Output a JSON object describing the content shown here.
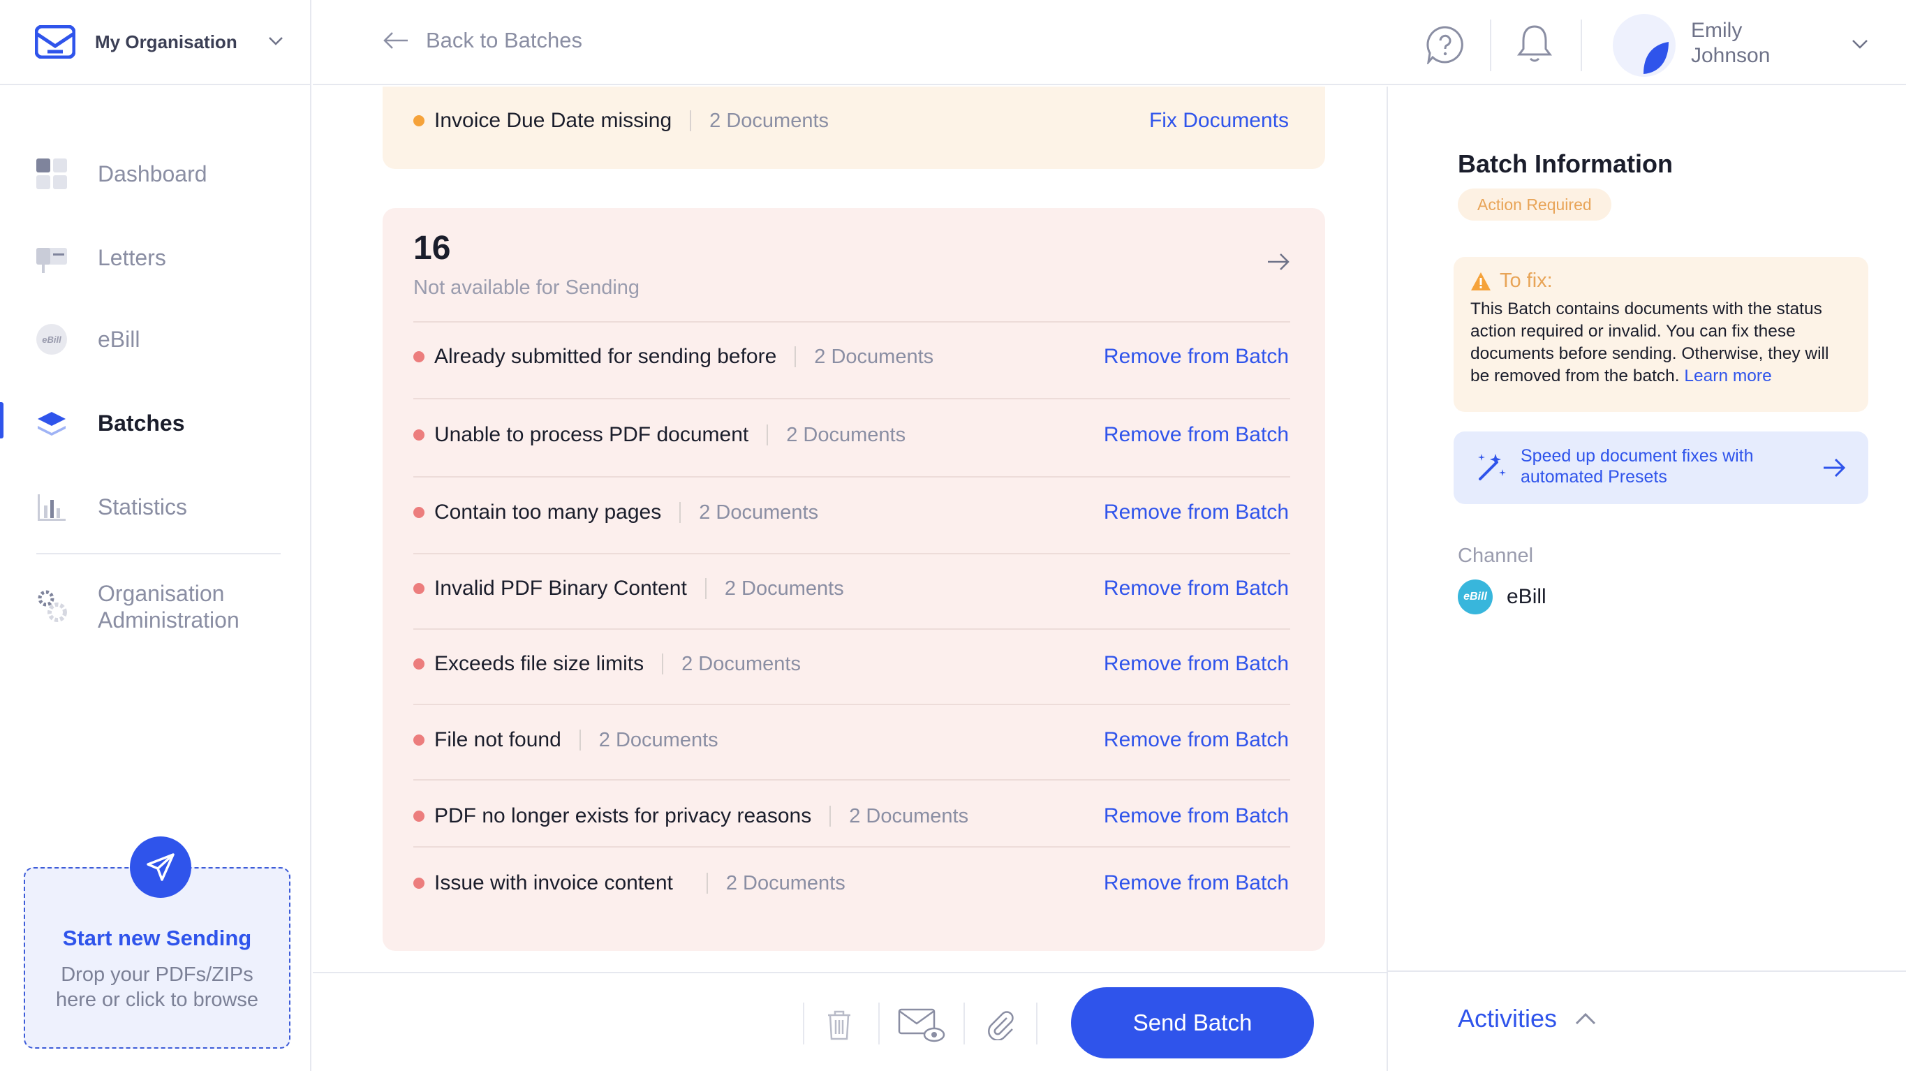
{
  "sidebar": {
    "org_name": "My Organisation",
    "nav": [
      {
        "label": "Dashboard",
        "icon": "dashboard-icon"
      },
      {
        "label": "Letters",
        "icon": "letters-icon"
      },
      {
        "label": "eBill",
        "icon": "ebill-icon"
      },
      {
        "label": "Batches",
        "icon": "batches-icon",
        "active": true
      },
      {
        "label": "Statistics",
        "icon": "statistics-icon"
      },
      {
        "label": "Organisation Administration",
        "icon": "settings-icon"
      }
    ],
    "ebill_badge": "eBill",
    "dropzone": {
      "title": "Start new Sending",
      "subtitle": "Drop your PDFs/ZIPs here or click to browse"
    }
  },
  "topbar": {
    "back_label": "Back to Batches",
    "user": {
      "first": "Emily",
      "last": "Johnson"
    }
  },
  "warning_group": {
    "issue": "Invoice Due Date missing",
    "count": "2 Documents",
    "action": "Fix Documents"
  },
  "error_group": {
    "count": "16",
    "subtitle": "Not available for Sending",
    "rows": [
      {
        "issue": "Already submitted for sending before",
        "count": "2 Documents",
        "action": "Remove from Batch"
      },
      {
        "issue": "Unable to process PDF document",
        "count": "2 Documents",
        "action": "Remove from Batch"
      },
      {
        "issue": "Contain too many pages",
        "count": "2 Documents",
        "action": "Remove from Batch"
      },
      {
        "issue": "Invalid PDF Binary Content",
        "count": "2 Documents",
        "action": "Remove from Batch"
      },
      {
        "issue": "Exceeds file size limits",
        "count": "2 Documents",
        "action": "Remove from Batch"
      },
      {
        "issue": "File not found",
        "count": "2 Documents",
        "action": "Remove from Batch"
      },
      {
        "issue": "PDF no longer exists for privacy reasons",
        "count": "2 Documents",
        "action": "Remove from Batch"
      },
      {
        "issue": "Issue with invoice content",
        "count": "2 Documents",
        "action": "Remove from Batch"
      }
    ]
  },
  "bottombar": {
    "send_label": "Send Batch"
  },
  "right_panel": {
    "title": "Batch Information",
    "status": "Action Required",
    "fix": {
      "title": "To fix:",
      "body": "This Batch contains documents with the status action required or invalid. You can fix these documents before sending. Otherwise, they will be removed from the batch.",
      "link": "Learn more"
    },
    "presets": "Speed up document fixes with automated Presets",
    "channel_label": "Channel",
    "channel_badge": "eBill",
    "channel_name": "eBill",
    "activities": "Activities"
  },
  "colors": {
    "accent": "#2f54eb",
    "warning": "#f5a23a",
    "error": "#ec7d7d",
    "warning_bg": "#fdf3e7",
    "error_bg": "#fcefed",
    "channel": "#38b6dc"
  }
}
